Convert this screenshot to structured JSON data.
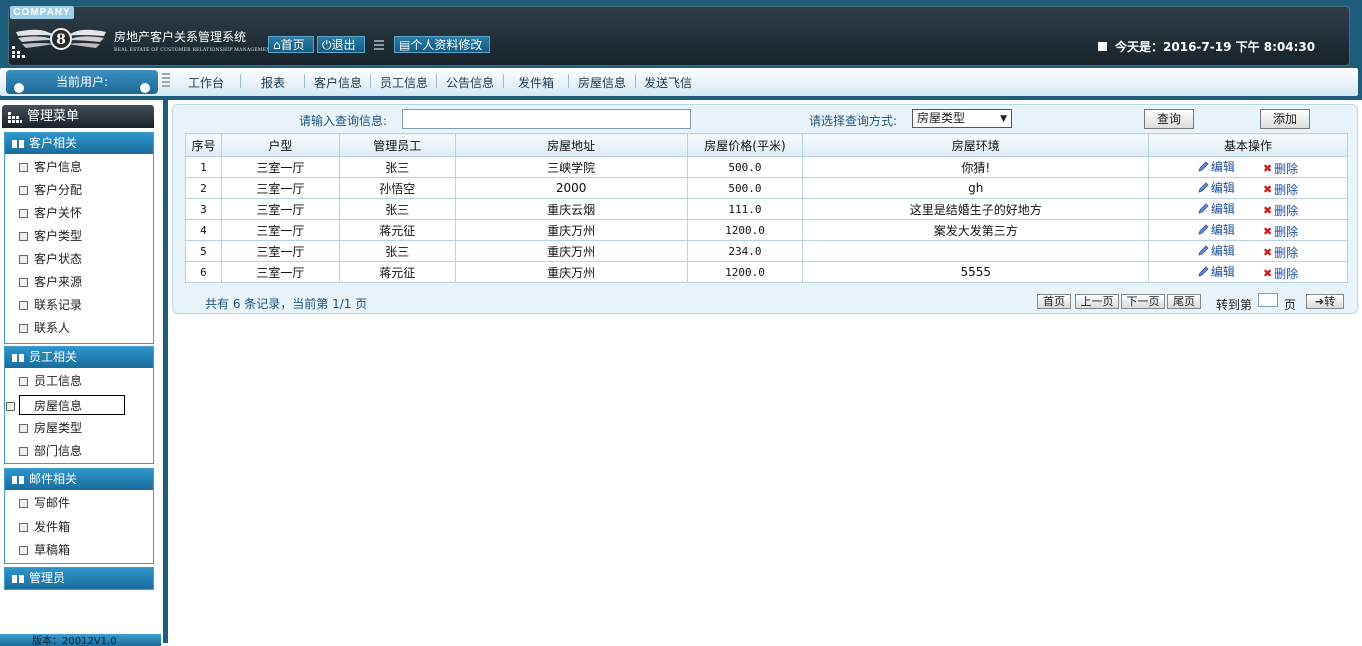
{
  "header": {
    "company": "COMPANY",
    "title": "房地产客户关系管理系统",
    "subtitle": "REAL ESTATE OF CUSTOMER RELATIONSHIP MANAGEMENT SYSTEM",
    "buttons": {
      "home": "首页",
      "exit": "退出",
      "profile": "个人资料修改"
    },
    "today_label": "今天是：",
    "today_value": "2016-7-19 下午 8:04:30"
  },
  "nav": {
    "current_user": "当前用户:",
    "items": [
      "工作台",
      "报表",
      "客户信息",
      "员工信息",
      "公告信息",
      "发件箱",
      "房屋信息",
      "发送飞信"
    ]
  },
  "sidebar": {
    "title": "管理菜单",
    "groups": [
      {
        "title": "客户相关",
        "items": [
          "客户信息",
          "客户分配",
          "客户关怀",
          "客户类型",
          "客户状态",
          "客户来源",
          "联系记录",
          "联系人"
        ]
      },
      {
        "title": "员工相关",
        "items": [
          "员工信息",
          "房屋信息",
          "房屋类型",
          "部门信息"
        ]
      },
      {
        "title": "邮件相关",
        "items": [
          "写邮件",
          "发件箱",
          "草稿箱"
        ]
      },
      {
        "title": "管理员",
        "items": []
      }
    ],
    "version": "版本：20012V1.0"
  },
  "search": {
    "label": "请输入查询信息:",
    "value": "",
    "mode_label": "请选择查询方式:",
    "mode_value": "房屋类型",
    "query_button": "查询",
    "add_button": "添加"
  },
  "table": {
    "columns": [
      "序号",
      "户型",
      "管理员工",
      "房屋地址",
      "房屋价格(平米)",
      "房屋环境",
      "基本操作"
    ],
    "edit_label": "编辑",
    "delete_label": "删除",
    "rows": [
      {
        "no": "1",
        "type": "三室一厅",
        "staff": "张三",
        "address": "三峡学院",
        "price": "500.0",
        "env": "你猜!"
      },
      {
        "no": "2",
        "type": "三室一厅",
        "staff": "孙悟空",
        "address": "2000",
        "price": "500.0",
        "env": "gh"
      },
      {
        "no": "3",
        "type": "三室一厅",
        "staff": "张三",
        "address": "重庆云烟",
        "price": "111.0",
        "env": "这里是结婚生子的好地方"
      },
      {
        "no": "4",
        "type": "三室一厅",
        "staff": "蒋元征",
        "address": "重庆万州",
        "price": "1200.0",
        "env": "案发大发第三方"
      },
      {
        "no": "5",
        "type": "三室一厅",
        "staff": "张三",
        "address": "重庆万州",
        "price": "234.0",
        "env": ""
      },
      {
        "no": "6",
        "type": "三室一厅",
        "staff": "蒋元征",
        "address": "重庆万州",
        "price": "1200.0",
        "env": "5555"
      }
    ]
  },
  "pager": {
    "info": "共有 6 条记录，当前第 1/1 页",
    "first": "首页",
    "prev": "上一页",
    "next": "下一页",
    "last": "尾页",
    "goto_label": "转到第",
    "goto_suffix": "页",
    "goto_button": "转"
  },
  "colors": {
    "frame": "#1e5c7c",
    "accent": "#2e95cb",
    "link": "#1e5680"
  }
}
